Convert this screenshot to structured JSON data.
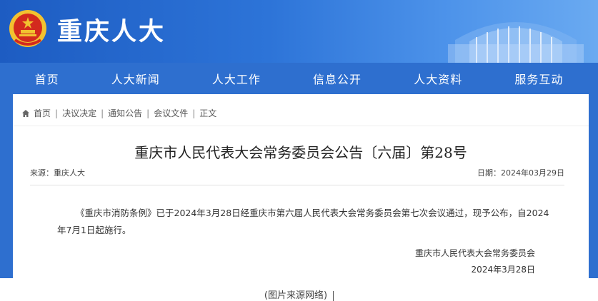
{
  "header": {
    "site_title": "重庆人大"
  },
  "nav": {
    "items": [
      "首页",
      "人大新闻",
      "人大工作",
      "信息公开",
      "人大资料",
      "服务互动"
    ]
  },
  "breadcrumb": {
    "items": [
      "首页",
      "决议决定",
      "通知公告",
      "会议文件",
      "正文"
    ],
    "separator": "|"
  },
  "article": {
    "title": "重庆市人民代表大会常务委员会公告〔六届〕第28号",
    "source": "来源：重庆人大",
    "date": "日期：2024年03月29日",
    "body": "《重庆市消防条例》已于2024年3月28日经重庆市第六届人民代表大会常务委员会第七次会议通过，现予公布，自2024年7月1日起施行。",
    "signature_org": "重庆市人民代表大会常务委员会",
    "signature_date": "2024年3月28日"
  },
  "caption": {
    "text": "(图片来源网络)"
  },
  "colors": {
    "banner_blue": "#2d74d8",
    "nav_blue": "#2e6fcf",
    "emblem_red": "#d32a1e",
    "emblem_gold": "#f2c230"
  },
  "icons": {
    "emblem": "national-emblem-icon",
    "home": "home-icon"
  }
}
